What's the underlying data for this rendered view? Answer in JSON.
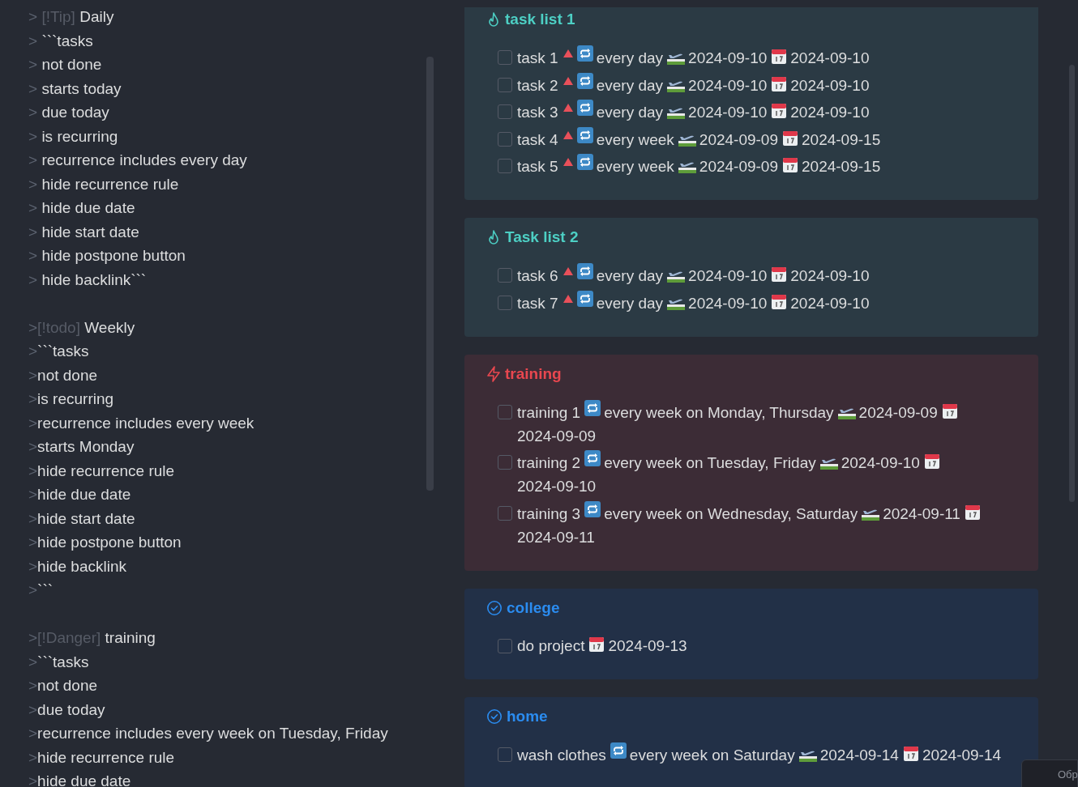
{
  "editor": {
    "blocks": [
      {
        "lines": [
          {
            "prefix": "> ",
            "tag": "[!Tip]",
            "text": "Daily"
          },
          {
            "prefix": "> ",
            "text": "```tasks"
          },
          {
            "prefix": "> ",
            "text": "not done"
          },
          {
            "prefix": "> ",
            "text": "starts today"
          },
          {
            "prefix": "> ",
            "text": "due today"
          },
          {
            "prefix": "> ",
            "text": "is recurring"
          },
          {
            "prefix": "> ",
            "text": "recurrence includes every day"
          },
          {
            "prefix": "> ",
            "text": "hide recurrence rule"
          },
          {
            "prefix": "> ",
            "text": "hide due date"
          },
          {
            "prefix": "> ",
            "text": "hide start date"
          },
          {
            "prefix": "> ",
            "text": "hide postpone button"
          },
          {
            "prefix": "> ",
            "text": "hide backlink```"
          }
        ]
      },
      {
        "lines": [
          {
            "prefix": ">",
            "tag": "[!todo]",
            "text": "Weekly"
          },
          {
            "prefix": ">",
            "text": "```tasks"
          },
          {
            "prefix": ">",
            "text": "not done"
          },
          {
            "prefix": ">",
            "text": "is recurring"
          },
          {
            "prefix": ">",
            "text": "recurrence includes every week"
          },
          {
            "prefix": ">",
            "text": "starts Monday"
          },
          {
            "prefix": ">",
            "text": "hide recurrence rule"
          },
          {
            "prefix": ">",
            "text": "hide due date"
          },
          {
            "prefix": ">",
            "text": "hide start date"
          },
          {
            "prefix": ">",
            "text": "hide postpone button"
          },
          {
            "prefix": ">",
            "text": "hide backlink"
          },
          {
            "prefix": ">",
            "text": "```"
          }
        ]
      },
      {
        "lines": [
          {
            "prefix": ">",
            "tag": "[!Danger]",
            "text": "training"
          },
          {
            "prefix": ">",
            "text": "```tasks"
          },
          {
            "prefix": ">",
            "text": "not done"
          },
          {
            "prefix": ">",
            "text": "due today"
          },
          {
            "prefix": ">",
            "text": "recurrence includes every week on Tuesday, Friday"
          },
          {
            "prefix": ">",
            "text": "hide recurrence rule"
          },
          {
            "prefix": ">",
            "text": "hide due date"
          }
        ]
      }
    ]
  },
  "callouts": [
    {
      "kind": "tip",
      "title": "task list 1",
      "tasks": [
        {
          "checked": false,
          "name": "task 1",
          "priority_high": true,
          "recurrence": "every day",
          "start": "2024-09-10",
          "due": "2024-09-10"
        },
        {
          "checked": false,
          "name": "task 2",
          "priority_high": true,
          "recurrence": "every day",
          "start": "2024-09-10",
          "due": "2024-09-10"
        },
        {
          "checked": false,
          "name": "task 3",
          "priority_high": true,
          "recurrence": "every day",
          "start": "2024-09-10",
          "due": "2024-09-10"
        },
        {
          "checked": false,
          "name": "task 4",
          "priority_high": true,
          "recurrence": "every week",
          "start": "2024-09-09",
          "due": "2024-09-15"
        },
        {
          "checked": false,
          "name": "task 5",
          "priority_high": true,
          "recurrence": "every week",
          "start": "2024-09-09",
          "due": "2024-09-15"
        }
      ]
    },
    {
      "kind": "tip",
      "title": "Task list 2",
      "tasks": [
        {
          "checked": false,
          "name": "task 6",
          "priority_high": true,
          "recurrence": "every day",
          "start": "2024-09-10",
          "due": "2024-09-10"
        },
        {
          "checked": false,
          "name": "task 7",
          "priority_high": true,
          "recurrence": "every day",
          "start": "2024-09-10",
          "due": "2024-09-10"
        }
      ]
    },
    {
      "kind": "danger",
      "title": "training",
      "tasks": [
        {
          "checked": false,
          "name": "training 1",
          "recurrence": "every week on Monday, Thursday",
          "start": "2024-09-09",
          "due": "2024-09-09"
        },
        {
          "checked": false,
          "name": "training 2",
          "recurrence": "every week on Tuesday, Friday",
          "start": "2024-09-10",
          "due": "2024-09-10"
        },
        {
          "checked": false,
          "name": "training 3",
          "recurrence": "every week on Wednesday, Saturday",
          "start": "2024-09-11",
          "due": "2024-09-11"
        }
      ]
    },
    {
      "kind": "todo",
      "title": "college",
      "tasks": [
        {
          "checked": false,
          "name": "do project",
          "due": "2024-09-13"
        }
      ]
    },
    {
      "kind": "todo",
      "title": "home",
      "tasks": [
        {
          "checked": false,
          "name": "wash clothes",
          "recurrence": "every week on Saturday",
          "start": "2024-09-14",
          "due": "2024-09-14"
        }
      ]
    }
  ],
  "tooltip": {
    "text": "Обр"
  }
}
